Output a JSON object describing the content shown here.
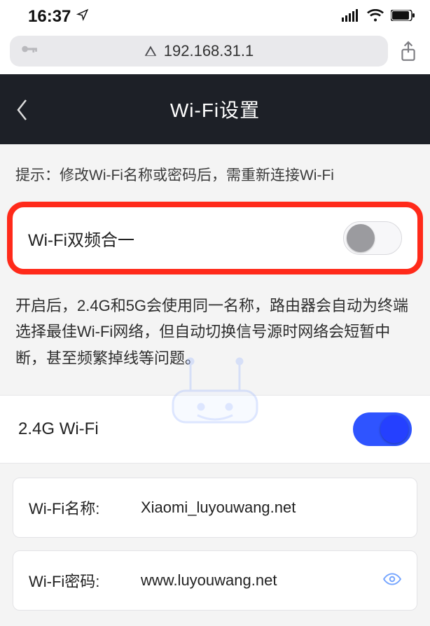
{
  "status": {
    "time": "16:37"
  },
  "browser": {
    "url": "192.168.31.1"
  },
  "header": {
    "title": "Wi-Fi设置"
  },
  "hint": {
    "text": "提示：修改Wi-Fi名称或密码后，需重新连接Wi-Fi"
  },
  "dualband": {
    "label": "Wi-Fi双频合一",
    "enabled": false,
    "description": "开启后，2.4G和5G会使用同一名称，路由器会自动为终端选择最佳Wi-Fi网络，但自动切换信号源时网络会短暂中断，甚至频繁掉线等问题。"
  },
  "band24": {
    "label": "2.4G Wi-Fi",
    "enabled": true
  },
  "fields": {
    "ssid": {
      "label": "Wi-Fi名称:",
      "value": "Xiaomi_luyouwang.net"
    },
    "password": {
      "label": "Wi-Fi密码:",
      "value": "www.luyouwang.net"
    }
  }
}
